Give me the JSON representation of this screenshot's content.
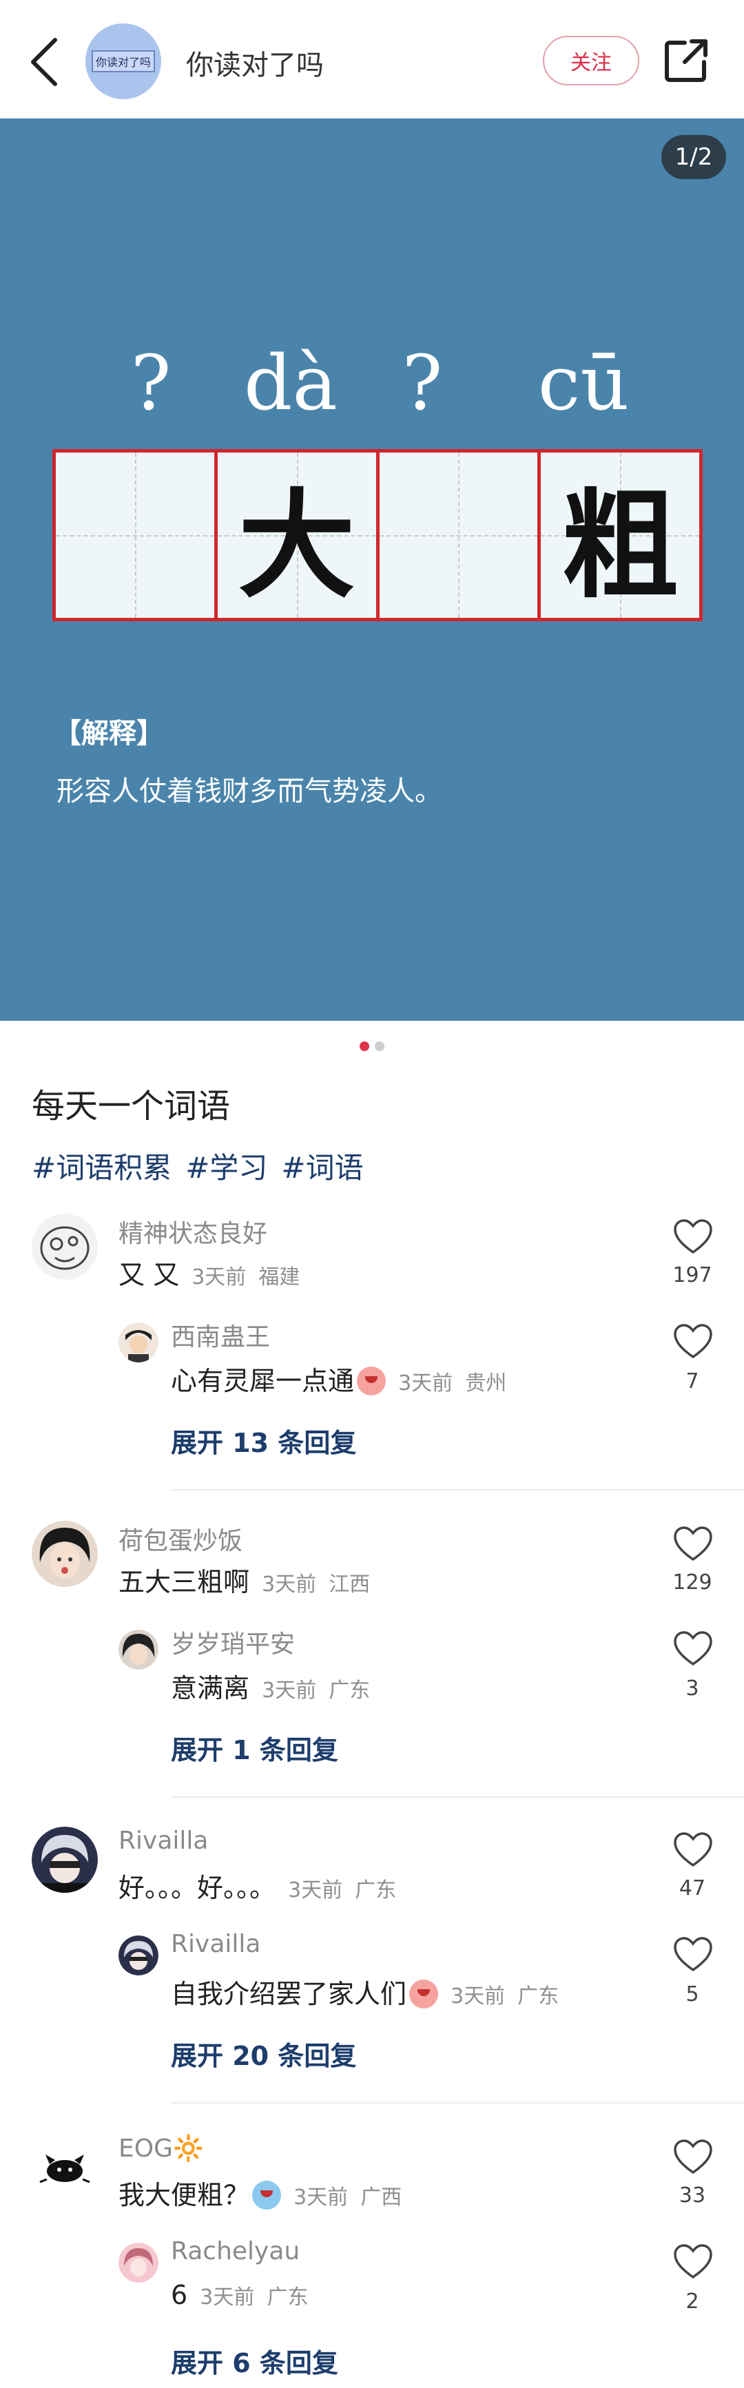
{
  "header": {
    "avatar_text": "你读对了吗",
    "title": "你读对了吗",
    "follow_label": "关注"
  },
  "hero": {
    "page_indicator": "1/2",
    "pinyin": [
      "?",
      "dà",
      "?",
      "cū"
    ],
    "characters": [
      "",
      "大",
      "",
      "粗"
    ],
    "explain_title": "【解释】",
    "explain_text": "形容人仗着钱财多而气势凌人。",
    "background": "#4a84ab",
    "grid_border": "#d0262c"
  },
  "carousel": {
    "total": 2,
    "active": 1
  },
  "post": {
    "title": "每天一个词语",
    "tags": [
      "#词语积累",
      "#学习",
      "#词语"
    ]
  },
  "comments": [
    {
      "user": "精神状态良好",
      "text": "又 又",
      "time": "3天前",
      "location": "福建",
      "likes": "197",
      "reply": {
        "user": "西南蛊王",
        "text": "心有灵犀一点通",
        "emoji": true,
        "time": "3天前",
        "location": "贵州",
        "likes": "7"
      },
      "expand": "展开 13 条回复"
    },
    {
      "user": "荷包蛋炒饭",
      "text": "五大三粗啊",
      "time": "3天前",
      "location": "江西",
      "likes": "129",
      "reply": {
        "user": "岁岁琑平安",
        "text": "意满离",
        "emoji": false,
        "time": "3天前",
        "location": "广东",
        "likes": "3"
      },
      "expand": "展开 1 条回复"
    },
    {
      "user": "Rivailla",
      "text": "好。。。好。。。",
      "time": "3天前",
      "location": "广东",
      "likes": "47",
      "reply": {
        "user": "Rivailla",
        "text": "自我介绍罢了家人们",
        "emoji": true,
        "time": "3天前",
        "location": "广东",
        "likes": "5"
      },
      "expand": "展开 20 条回复"
    },
    {
      "user": "EOG🔆",
      "text": "我大便粗？",
      "time": "3天前",
      "location": "广西",
      "likes": "33",
      "reply": {
        "user": "Rachelyau",
        "text": "6",
        "emoji": false,
        "time": "3天前",
        "location": "广东",
        "likes": "2"
      },
      "expand": "展开 6 条回复"
    }
  ]
}
